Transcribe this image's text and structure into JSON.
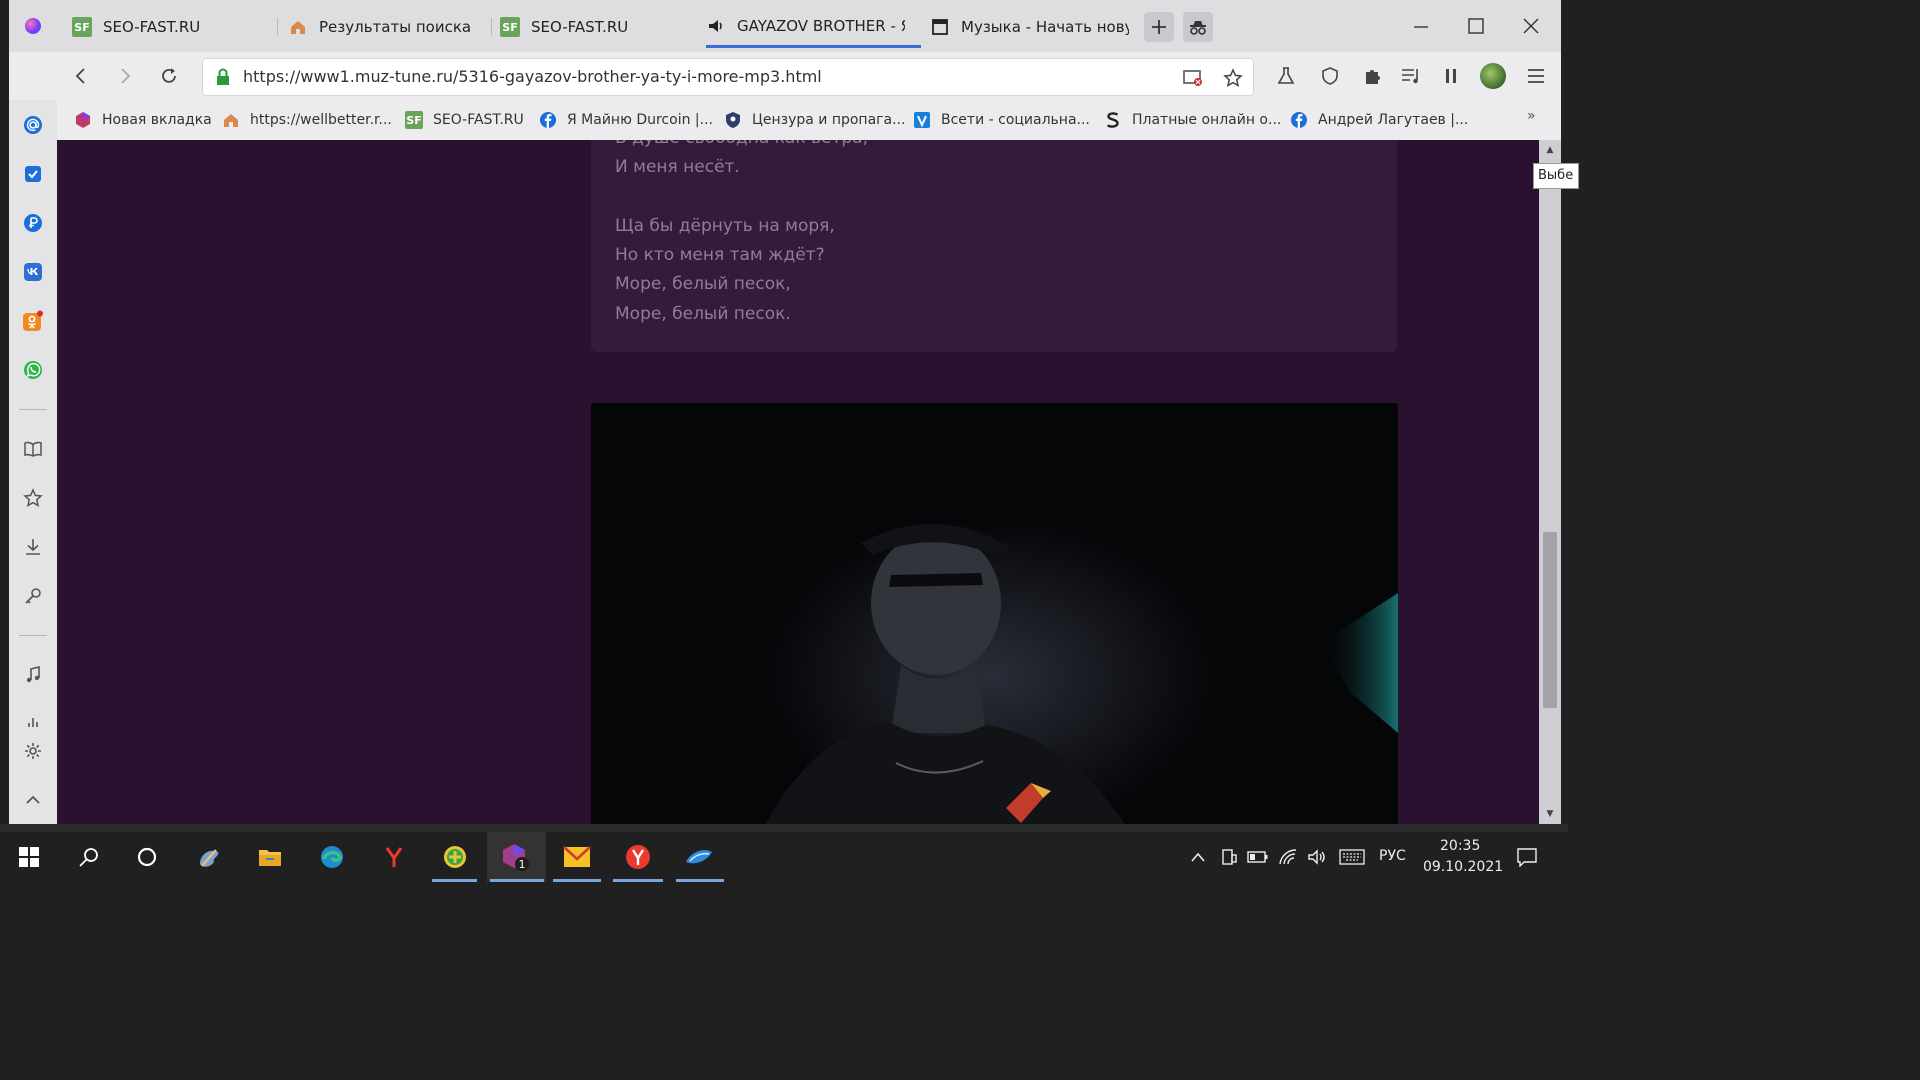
{
  "tabs": [
    {
      "label": "SEO-FAST.RU",
      "icon": "sf-icon"
    },
    {
      "label": "Результаты поиска",
      "icon": "house-icon"
    },
    {
      "label": "SEO-FAST.RU",
      "icon": "sf-icon"
    },
    {
      "label": "GAYAZOV BROTHER - Я",
      "icon": "speaker-icon",
      "active": true
    },
    {
      "label": "Музыка - Начать нову",
      "icon": "window-icon"
    }
  ],
  "sf_badge": "SF",
  "address_bar": {
    "url": "https://www1.muz-tune.ru/5316-gayazov-brother-ya-ty-i-more-mp3.html"
  },
  "bookmarks": [
    {
      "label": "Новая вкладка",
      "icon": "gem-icon"
    },
    {
      "label": "https://wellbetter.r...",
      "icon": "house-icon"
    },
    {
      "label": "SEO-FAST.RU",
      "icon": "sf-icon"
    },
    {
      "label": "Я Майню Durcoin |...",
      "icon": "facebook-icon"
    },
    {
      "label": "Цензура и пропага...",
      "icon": "shield-icon"
    },
    {
      "label": "Всети - социальна...",
      "icon": "v-icon"
    },
    {
      "label": "Платные онлайн о...",
      "icon": "s-icon"
    },
    {
      "label": "Андрей Лагутаев |...",
      "icon": "facebook-icon"
    }
  ],
  "bookmarks_more": "»",
  "lyrics": {
    "partial": "В душе свободна как ветра,",
    "lines": [
      "И меня несёт.",
      "Ща бы дёрнуть на моря,",
      "Но кто меня там ждёт?",
      "Море, белый песок,",
      "Море, белый песок."
    ]
  },
  "tooltip": "Выбе",
  "taskbar": {
    "language": "РУС",
    "time": "20:35",
    "date": "09.10.2021",
    "badge": "1"
  },
  "colors": {
    "accent": "#3b6dd8",
    "page_bg": "#2a1130",
    "lyrics_card": "#341a3b",
    "lyric_text": "#8f7e94"
  }
}
